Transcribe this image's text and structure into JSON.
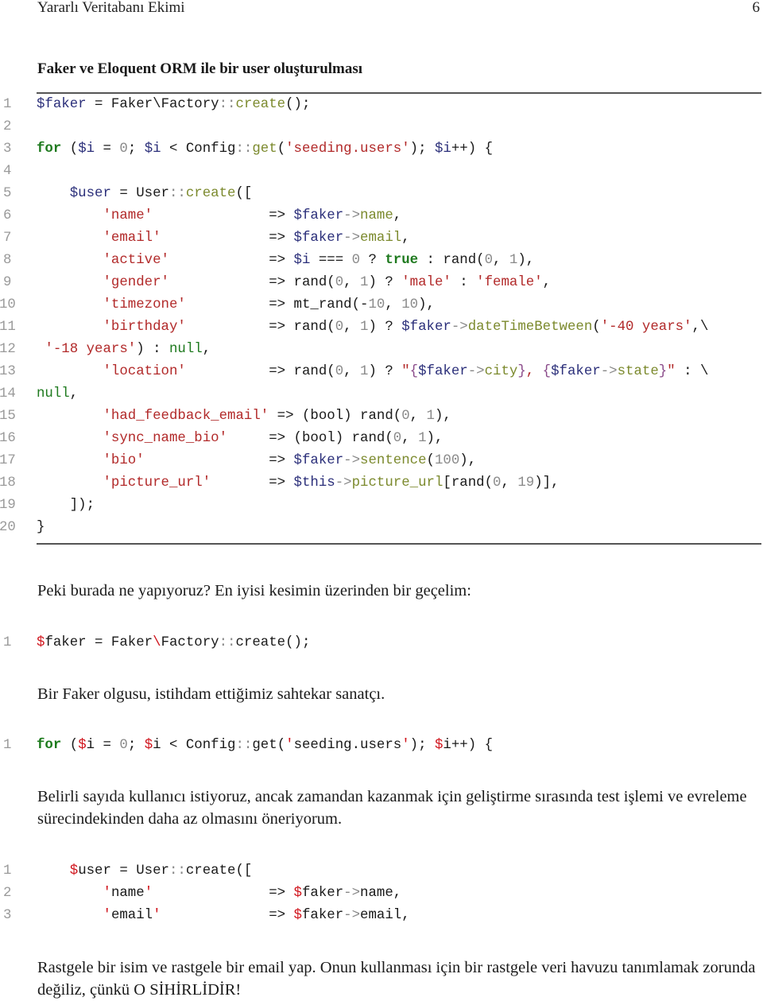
{
  "header": {
    "title": "Yararlı Veritabanı Ekimi",
    "page_number": "6"
  },
  "listing": {
    "caption": "Faker ve Eloquent ORM ile bir user oluşturulması",
    "lines": [
      {
        "n": "1",
        "code": "$faker = Faker\\Factory::create();"
      },
      {
        "n": "2",
        "code": ""
      },
      {
        "n": "3",
        "code": "for ($i = 0; $i < Config::get('seeding.users'); $i++) {"
      },
      {
        "n": "4",
        "code": ""
      },
      {
        "n": "5",
        "code": "    $user = User::create(["
      },
      {
        "n": "6",
        "code": "        'name'              => $faker->name,"
      },
      {
        "n": "7",
        "code": "        'email'             => $faker->email,"
      },
      {
        "n": "8",
        "code": "        'active'            => $i === 0 ? true : rand(0, 1),"
      },
      {
        "n": "9",
        "code": "        'gender'            => rand(0, 1) ? 'male' : 'female',"
      },
      {
        "n": "10",
        "code": "        'timezone'          => mt_rand(-10, 10),"
      },
      {
        "n": "11",
        "code": "        'birthday'          => rand(0, 1) ? $faker->dateTimeBetween('-40 years',\\"
      },
      {
        "n": "12",
        "code": " '-18 years') : null,"
      },
      {
        "n": "13",
        "code": "        'location'          => rand(0, 1) ? \"{$faker->city}, {$faker->state}\" : \\"
      },
      {
        "n": "14",
        "code": "null,"
      },
      {
        "n": "15",
        "code": "        'had_feedback_email' => (bool) rand(0, 1),"
      },
      {
        "n": "16",
        "code": "        'sync_name_bio'     => (bool) rand(0, 1),"
      },
      {
        "n": "17",
        "code": "        'bio'               => $faker->sentence(100),"
      },
      {
        "n": "18",
        "code": "        'picture_url'       => $this->picture_url[rand(0, 19)],"
      },
      {
        "n": "19",
        "code": "    ]);"
      },
      {
        "n": "20",
        "code": "}"
      }
    ]
  },
  "paragraphs": {
    "p1": "Peki burada ne yapıyoruz? En iyisi kesimin üzerinden bir geçelim:",
    "p2": "Bir Faker olgusu, istihdam ettiğimiz sahtekar sanatçı.",
    "p3": "Belirli sayıda kullanıcı istiyoruz, ancak zamandan kazanmak için geliştirme sırasında test işlemi ve evreleme sürecindekinden daha az olmasını öneriyorum.",
    "p4": "Rastgele bir isim ve rastgele bir email yap. Onun kullanması için bir rastgele veri havuzu tanımlamak zorunda değiliz, çünkü O SİHİRLİDİR!"
  },
  "snippet1": {
    "lines": [
      {
        "n": "1",
        "code": "$faker = Faker\\Factory::create();"
      }
    ]
  },
  "snippet2": {
    "lines": [
      {
        "n": "1",
        "code": "for ($i = 0; $i < Config::get('seeding.users'); $i++) {"
      }
    ]
  },
  "snippet3": {
    "lines": [
      {
        "n": "1",
        "code": "    $user = User::create(["
      },
      {
        "n": "2",
        "code": "        'name'              => $faker->name,"
      },
      {
        "n": "3",
        "code": "        'email'             => $faker->email,"
      }
    ]
  },
  "colors": {
    "variable": "#2b2f7a",
    "method": "#7c8a2e",
    "string": "#b22a2a",
    "keyword": "#1f7a1f",
    "number": "#8a8a8a",
    "dollar_alt": "#d0141c",
    "line_number": "#9a9a9a",
    "rule": "#555555"
  }
}
